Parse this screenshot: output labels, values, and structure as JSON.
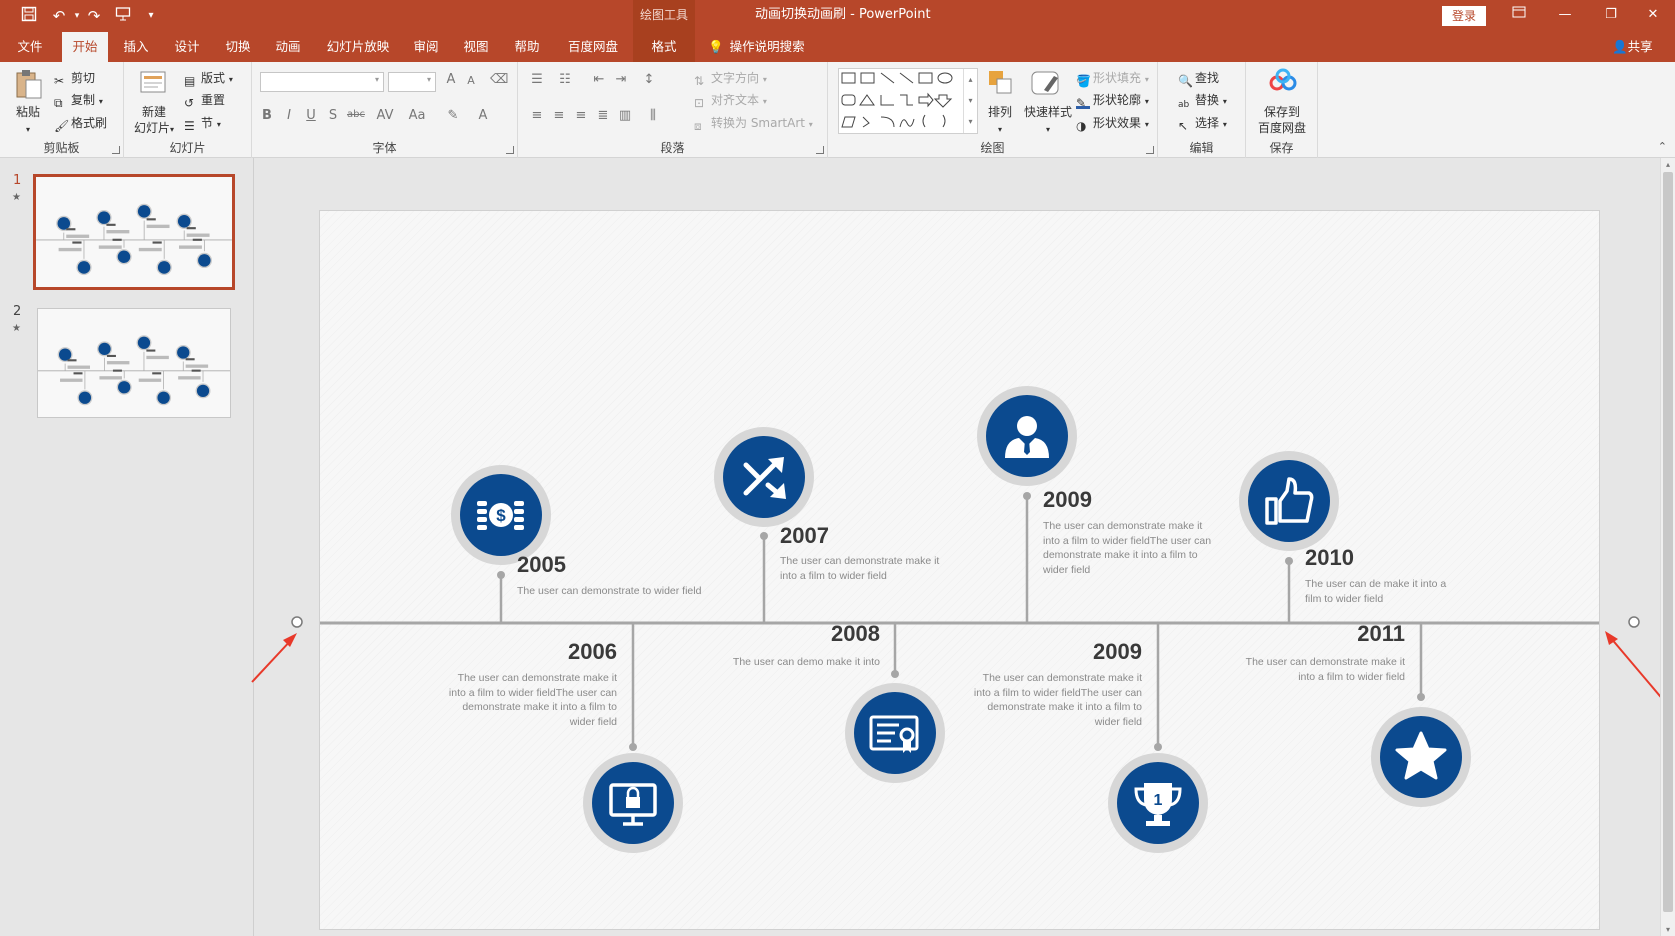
{
  "titlebar": {
    "context_tool": "绘图工具",
    "document_title": "动画切换动画刷  -  PowerPoint",
    "login": "登录"
  },
  "tabs": [
    "文件",
    "开始",
    "插入",
    "设计",
    "切换",
    "动画",
    "幻灯片放映",
    "审阅",
    "视图",
    "帮助",
    "百度网盘",
    "格式"
  ],
  "active_tab": "开始",
  "tell_me": "操作说明搜索",
  "share": "共享",
  "ribbon": {
    "clipboard": {
      "label": "剪贴板",
      "paste": "粘贴",
      "cut": "剪切",
      "copy": "复制",
      "format_painter": "格式刷"
    },
    "slides": {
      "label": "幻灯片",
      "new_slide_line1": "新建",
      "new_slide_line2": "幻灯片",
      "layout": "版式",
      "reset": "重置",
      "section": "节"
    },
    "font": {
      "label": "字体",
      "bold": "B",
      "italic": "I",
      "underline": "U",
      "shadow": "S",
      "strike": "abc",
      "spacing": "AV",
      "case": "Aa",
      "grow": "A",
      "shrink": "A"
    },
    "paragraph": {
      "label": "段落",
      "text_direction": "文字方向",
      "align_text": "对齐文本",
      "smartart": "转换为 SmartArt"
    },
    "drawing": {
      "label": "绘图",
      "arrange": "排列",
      "quick_styles": "快速样式",
      "shape_fill": "形状填充",
      "shape_outline": "形状轮廓",
      "shape_effects": "形状效果"
    },
    "editing": {
      "label": "编辑",
      "find": "查找",
      "replace": "替换",
      "select": "选择"
    },
    "save": {
      "label": "保存",
      "save_to_line1": "保存到",
      "save_to_line2": "百度网盘"
    }
  },
  "thumbnails": [
    {
      "number": "1",
      "star": "★"
    },
    {
      "number": "2",
      "star": "★"
    }
  ],
  "timeline": {
    "top": [
      {
        "year": "2005",
        "desc": "The user can demonstrate to wider field",
        "icon": "money-icon"
      },
      {
        "year": "2007",
        "desc": "The user can demonstrate make it into a film to wider field",
        "icon": "shuffle-icon"
      },
      {
        "year": "2009",
        "desc": "The user can demonstrate make it into a film to wider fieldThe user can demonstrate make it into a film to wider field",
        "icon": "person-icon"
      },
      {
        "year": "2010",
        "desc": "The user can de make it into a film to wider field",
        "icon": "thumbs-up-icon"
      }
    ],
    "bottom": [
      {
        "year": "2006",
        "desc": "The user can demonstrate make it into a film to wider fieldThe user can demonstrate make it into a film to wider field",
        "icon": "monitor-lock-icon"
      },
      {
        "year": "2008",
        "desc": "The user can demo make it into",
        "icon": "certificate-icon"
      },
      {
        "year": "2009",
        "desc": "The user can demonstrate make it into a film to wider fieldThe user can demonstrate make it into a film to wider field",
        "icon": "trophy-icon"
      },
      {
        "year": "2011",
        "desc": "The user can demonstrate make it into a film to wider field",
        "icon": "star-icon"
      }
    ]
  },
  "colors": {
    "accent": "#b7472a",
    "icon_blue": "#0b4a8f",
    "ring": "#d7d7d7",
    "line": "#a6a6a6",
    "arrow": "#e8392a"
  }
}
